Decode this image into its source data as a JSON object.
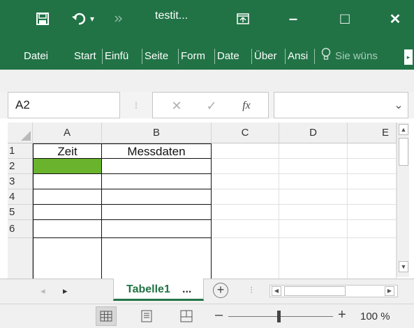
{
  "titlebar": {
    "title": "testit...",
    "undo_dropdown_glyph": "▾",
    "minimize_glyph": "–",
    "maximize_glyph": "□",
    "close_glyph": "✕",
    "icons": [
      "save-icon",
      "undo-icon",
      "redo-icon",
      "ribbon-display-icon"
    ]
  },
  "ribbon": {
    "tabs": [
      "Datei",
      "Start",
      "Einfü",
      "Seite",
      "Form",
      "Date",
      "Über",
      "Ansi"
    ],
    "tellme": "Sie wüns",
    "scroll_glyph": "▸"
  },
  "formula_bar": {
    "name_box": "A2",
    "cancel_glyph": "✕",
    "enter_glyph": "✓",
    "fx_glyph": "fx",
    "expand_glyph": "⌄",
    "formula": ""
  },
  "sheet": {
    "columns": [
      "A",
      "B",
      "C",
      "D",
      "E"
    ],
    "rows": [
      {
        "num": "1",
        "cells": [
          "Zeit",
          "Messdaten",
          "",
          "",
          ""
        ]
      },
      {
        "num": "2",
        "cells": [
          "",
          "",
          "",
          "",
          ""
        ]
      },
      {
        "num": "3",
        "cells": [
          "",
          "",
          "",
          "",
          ""
        ]
      },
      {
        "num": "4",
        "cells": [
          "",
          "",
          "",
          "",
          ""
        ]
      },
      {
        "num": "5",
        "cells": [
          "",
          "",
          "",
          "",
          ""
        ]
      },
      {
        "num": "6",
        "cells": [
          "",
          "",
          "",
          "",
          ""
        ]
      }
    ],
    "active_cell": "A2",
    "active_fill": "#6ab42d"
  },
  "tabs": {
    "sheet_name": "Tabelle1",
    "ellipsis": "...",
    "add_glyph": "+",
    "prev_glyph": "◂",
    "next_glyph": "▸"
  },
  "status": {
    "zoom": "100 %",
    "zoom_minus": "–",
    "zoom_plus": "+",
    "views": [
      "normal-view-icon",
      "page-layout-icon",
      "page-break-icon"
    ]
  },
  "colors": {
    "brand": "#217346",
    "accent_green": "#6ab42d"
  }
}
